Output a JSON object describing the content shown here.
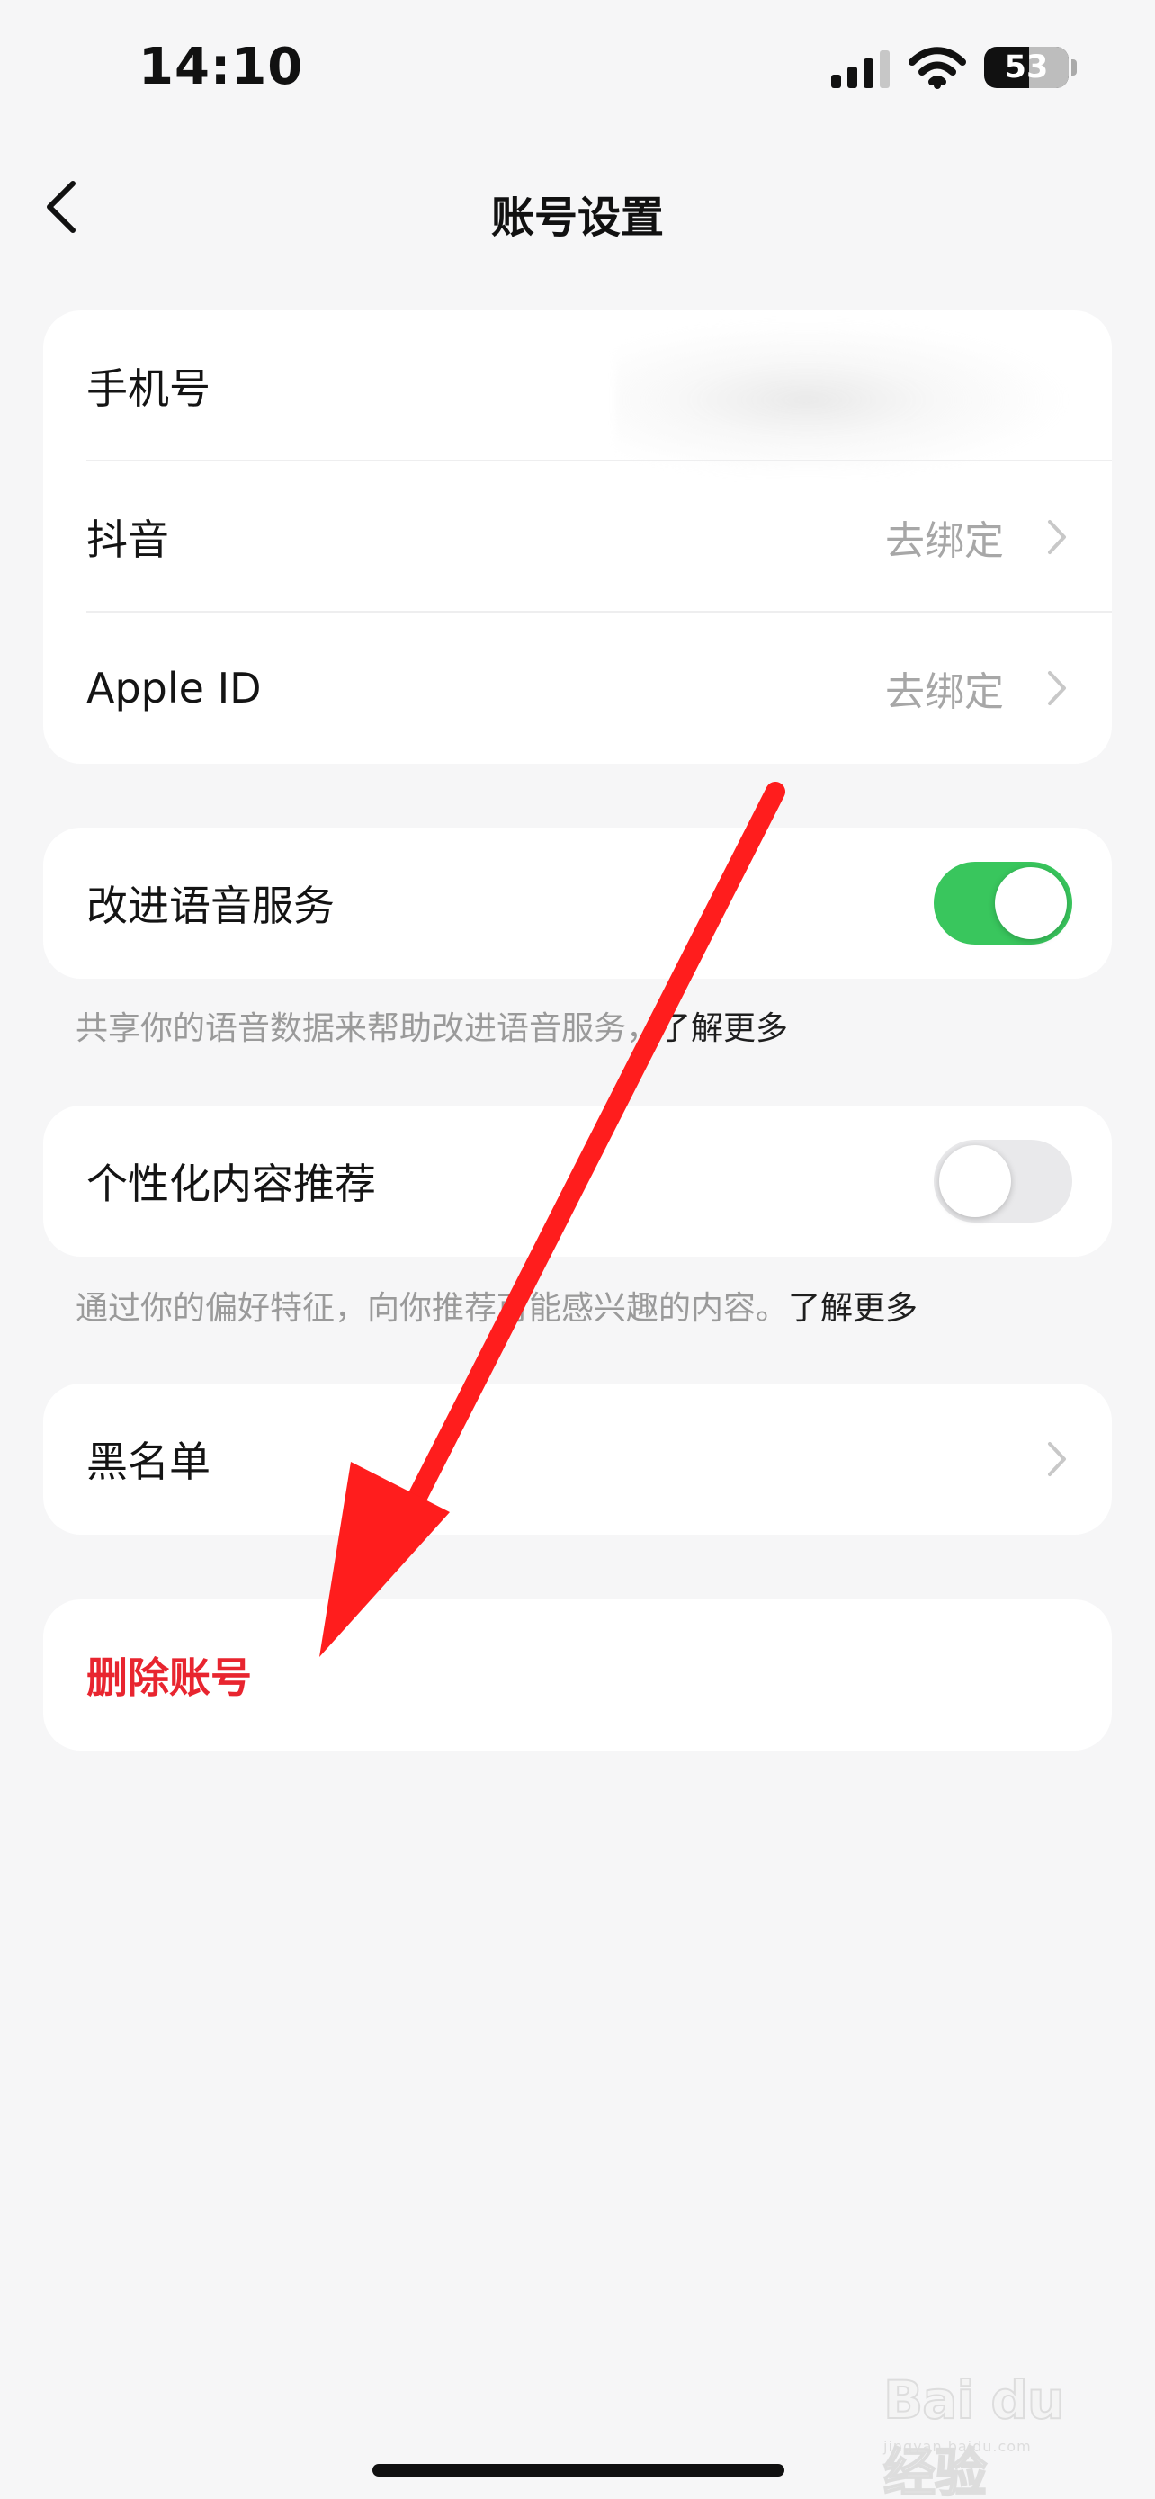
{
  "status_bar": {
    "time": "14:10",
    "battery_text": "53",
    "battery_level": 0.53,
    "icons": [
      "cellular-signal-icon",
      "wifi-icon",
      "battery-icon"
    ]
  },
  "nav": {
    "back_icon": "chevron-left-icon",
    "title": "账号设置"
  },
  "account_card": {
    "rows": [
      {
        "label": "手机号",
        "value": ""
      },
      {
        "label": "抖音",
        "value": "去绑定"
      },
      {
        "label": "Apple ID",
        "value": "去绑定"
      }
    ]
  },
  "voice_service": {
    "label": "改进语音服务",
    "enabled": true,
    "caption": "共享你的语音数据来帮助改进语音服务，",
    "link": "了解更多"
  },
  "personalized_content": {
    "label": "个性化内容推荐",
    "enabled": false,
    "caption": "通过你的偏好特征，向你推荐可能感兴趣的内容。",
    "link": "了解更多"
  },
  "blacklist": {
    "label": "黑名单"
  },
  "delete_account": {
    "label": "删除账号",
    "color": "#e8252f"
  },
  "colors": {
    "background": "#f6f6f7",
    "card": "#ffffff",
    "switch_on": "#39c65d",
    "switch_off": "#e9e9eb",
    "annotation_arrow": "#ff1d1d"
  },
  "watermark": {
    "logo": "Bai du 经验",
    "url": "jingyan.baidu.com"
  }
}
